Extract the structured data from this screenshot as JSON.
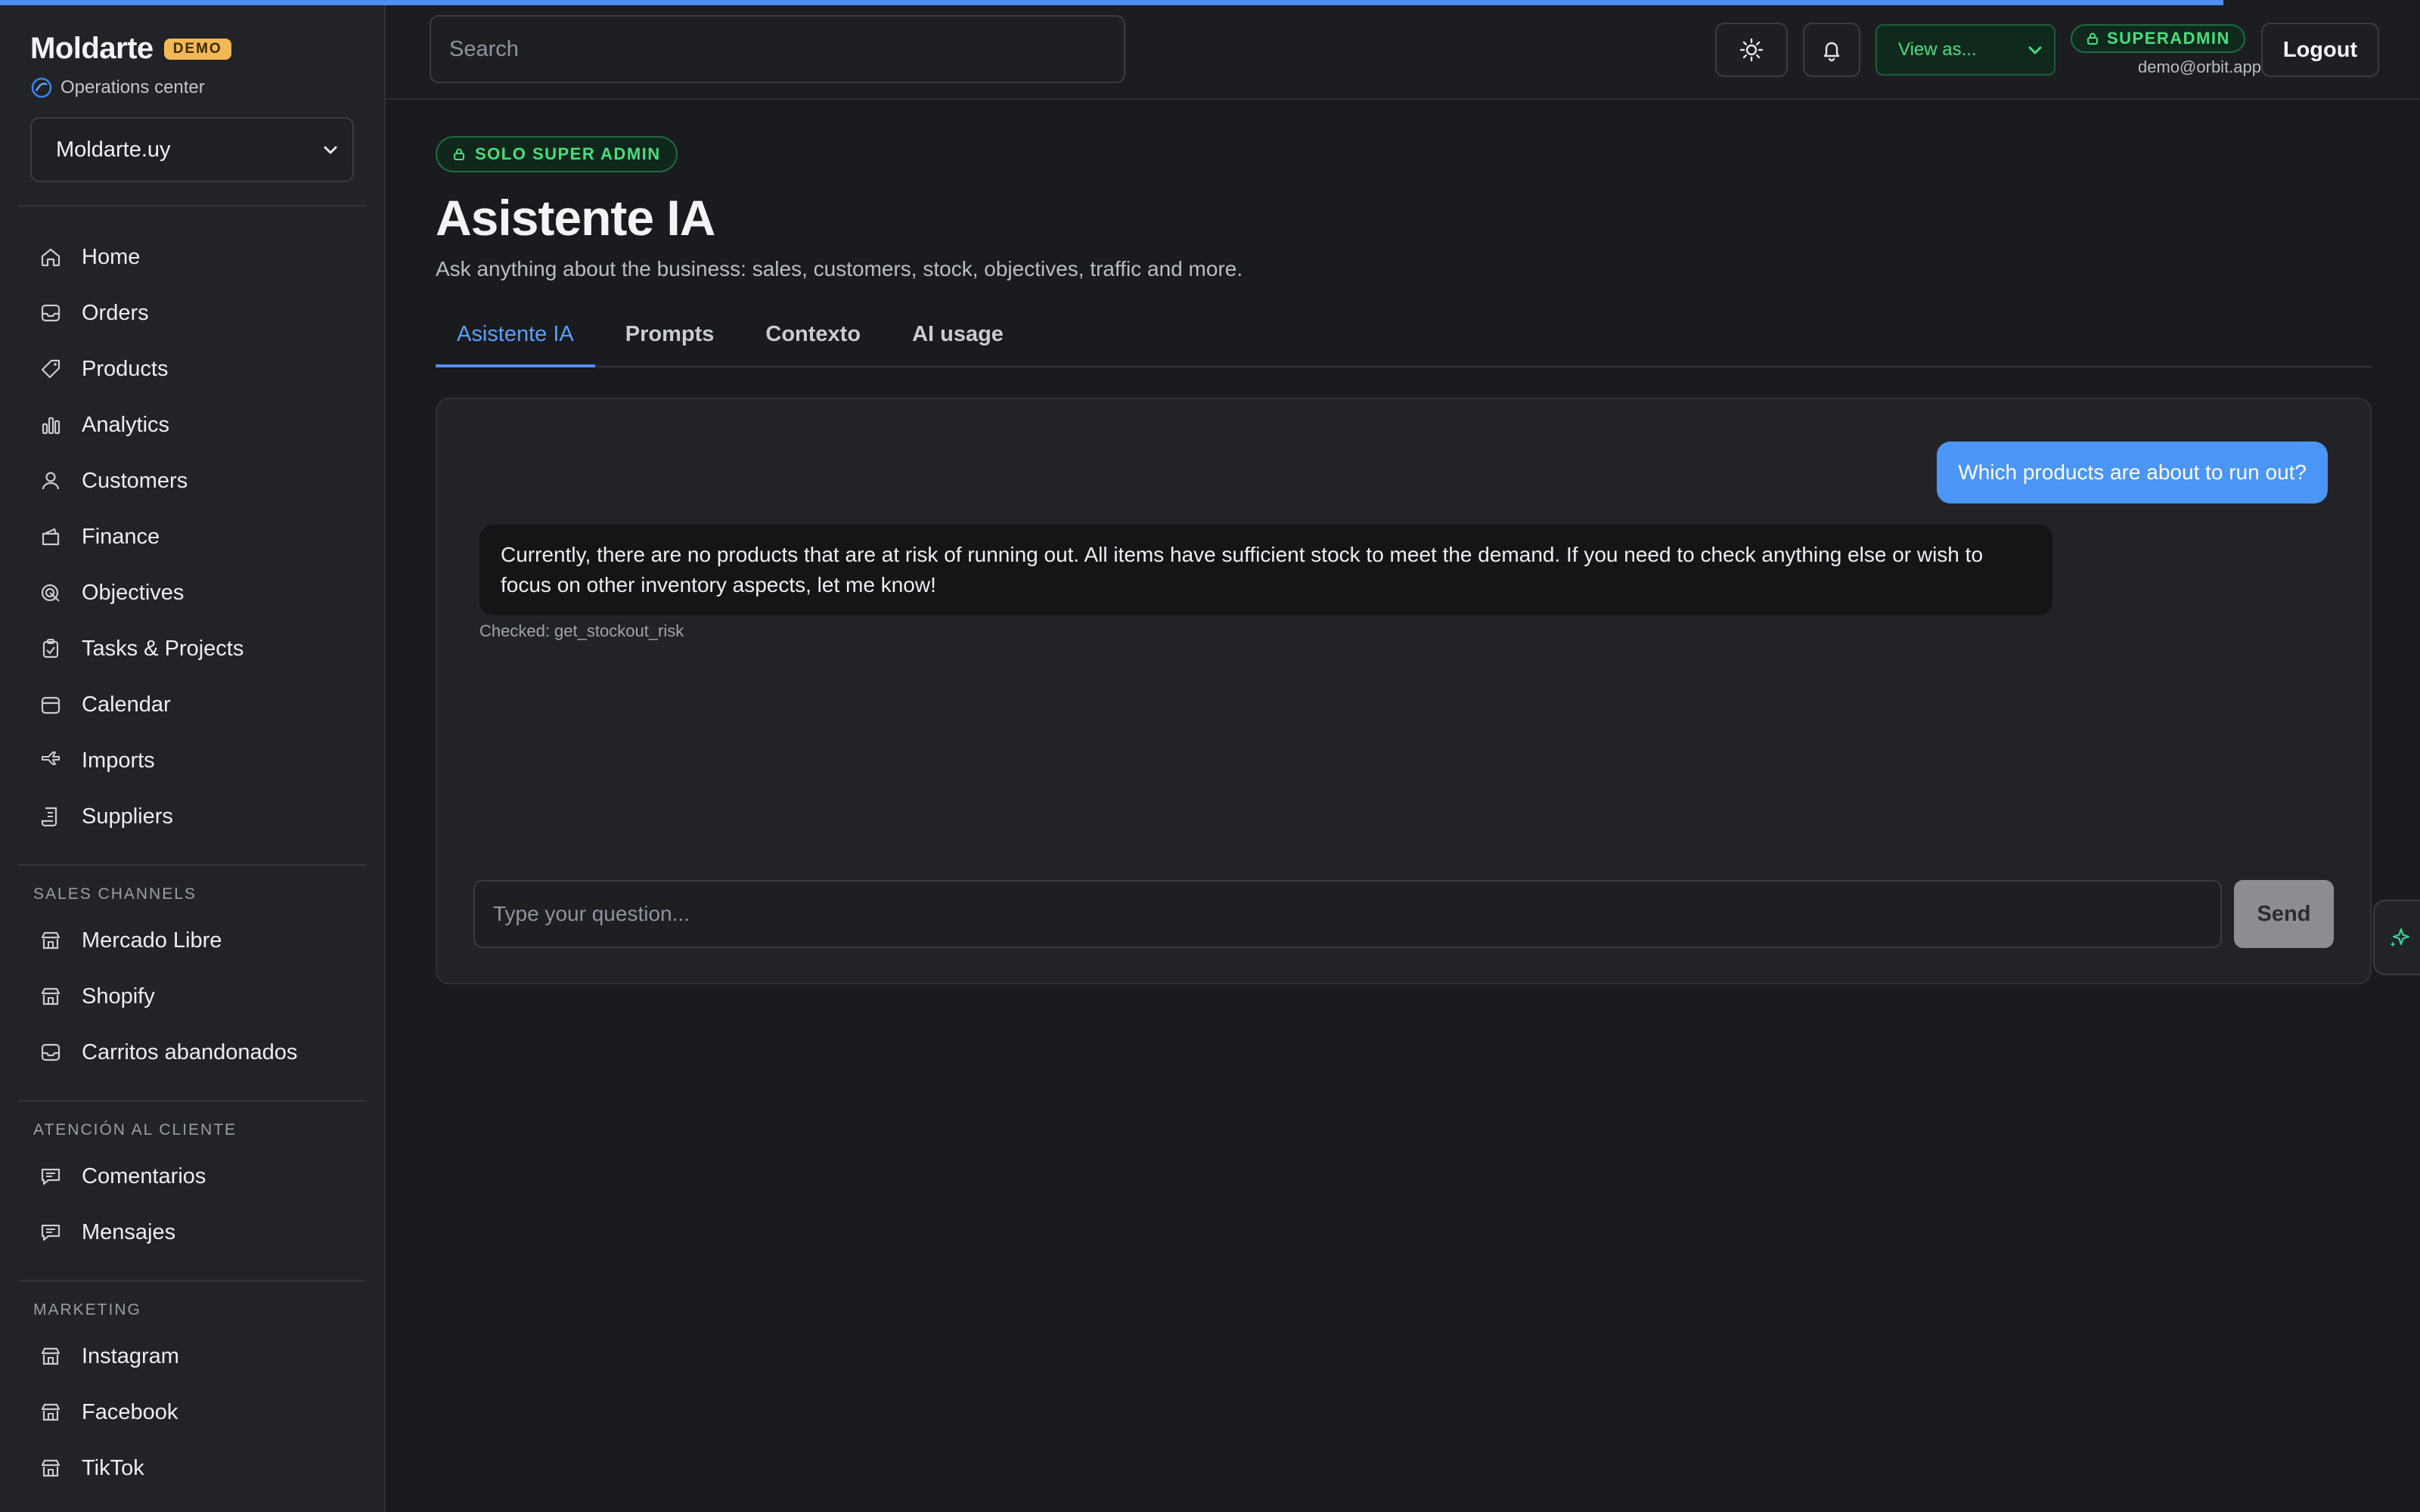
{
  "brand": {
    "name": "Moldarte",
    "badge": "DEMO",
    "subtitle": "Operations center",
    "store_selected": "Moldarte.uy"
  },
  "sidebar": {
    "main_items": [
      {
        "label": "Home",
        "icon": "home-icon"
      },
      {
        "label": "Orders",
        "icon": "inbox-icon"
      },
      {
        "label": "Products",
        "icon": "tag-icon"
      },
      {
        "label": "Analytics",
        "icon": "bar-chart-icon"
      },
      {
        "label": "Customers",
        "icon": "user-icon"
      },
      {
        "label": "Finance",
        "icon": "wallet-icon"
      },
      {
        "label": "Objectives",
        "icon": "target-icon"
      },
      {
        "label": "Tasks & Projects",
        "icon": "clipboard-check-icon"
      },
      {
        "label": "Calendar",
        "icon": "calendar-icon"
      },
      {
        "label": "Imports",
        "icon": "plane-icon"
      },
      {
        "label": "Suppliers",
        "icon": "scroll-icon"
      }
    ],
    "sections": [
      {
        "title": "Sales channels",
        "items": [
          {
            "label": "Mercado Libre",
            "icon": "store-icon"
          },
          {
            "label": "Shopify",
            "icon": "store-icon"
          },
          {
            "label": "Carritos abandonados",
            "icon": "inbox-icon"
          }
        ]
      },
      {
        "title": "Atención al cliente",
        "items": [
          {
            "label": "Comentarios",
            "icon": "message-icon"
          },
          {
            "label": "Mensajes",
            "icon": "message-icon"
          }
        ]
      },
      {
        "title": "Marketing",
        "items": [
          {
            "label": "Instagram",
            "icon": "store-icon"
          },
          {
            "label": "Facebook",
            "icon": "store-icon"
          },
          {
            "label": "TikTok",
            "icon": "store-icon"
          }
        ]
      }
    ]
  },
  "header": {
    "search_placeholder": "Search",
    "view_as": "View as...",
    "role": "SUPERADMIN",
    "email": "demo@orbit.app",
    "logout": "Logout"
  },
  "page": {
    "chip": "SOLO SUPER ADMIN",
    "title": "Asistente IA",
    "subtitle": "Ask anything about the business: sales, customers, stock, objectives, traffic and more.",
    "tabs": [
      "Asistente IA",
      "Prompts",
      "Contexto",
      "AI usage"
    ],
    "active_tab": 0
  },
  "chat": {
    "user_message": "Which products are about to run out?",
    "bot_message": "Currently, there are no products that are at risk of running out. All items have sufficient stock to meet the demand. If you need to check anything else or wish to focus on other inventory aspects, let me know!",
    "tool_note": "Checked: get_stockout_risk",
    "input_placeholder": "Type your question...",
    "send_label": "Send"
  },
  "colors": {
    "accent": "#4f8ff7",
    "success": "#4ade80",
    "badge": "#f1b955"
  }
}
